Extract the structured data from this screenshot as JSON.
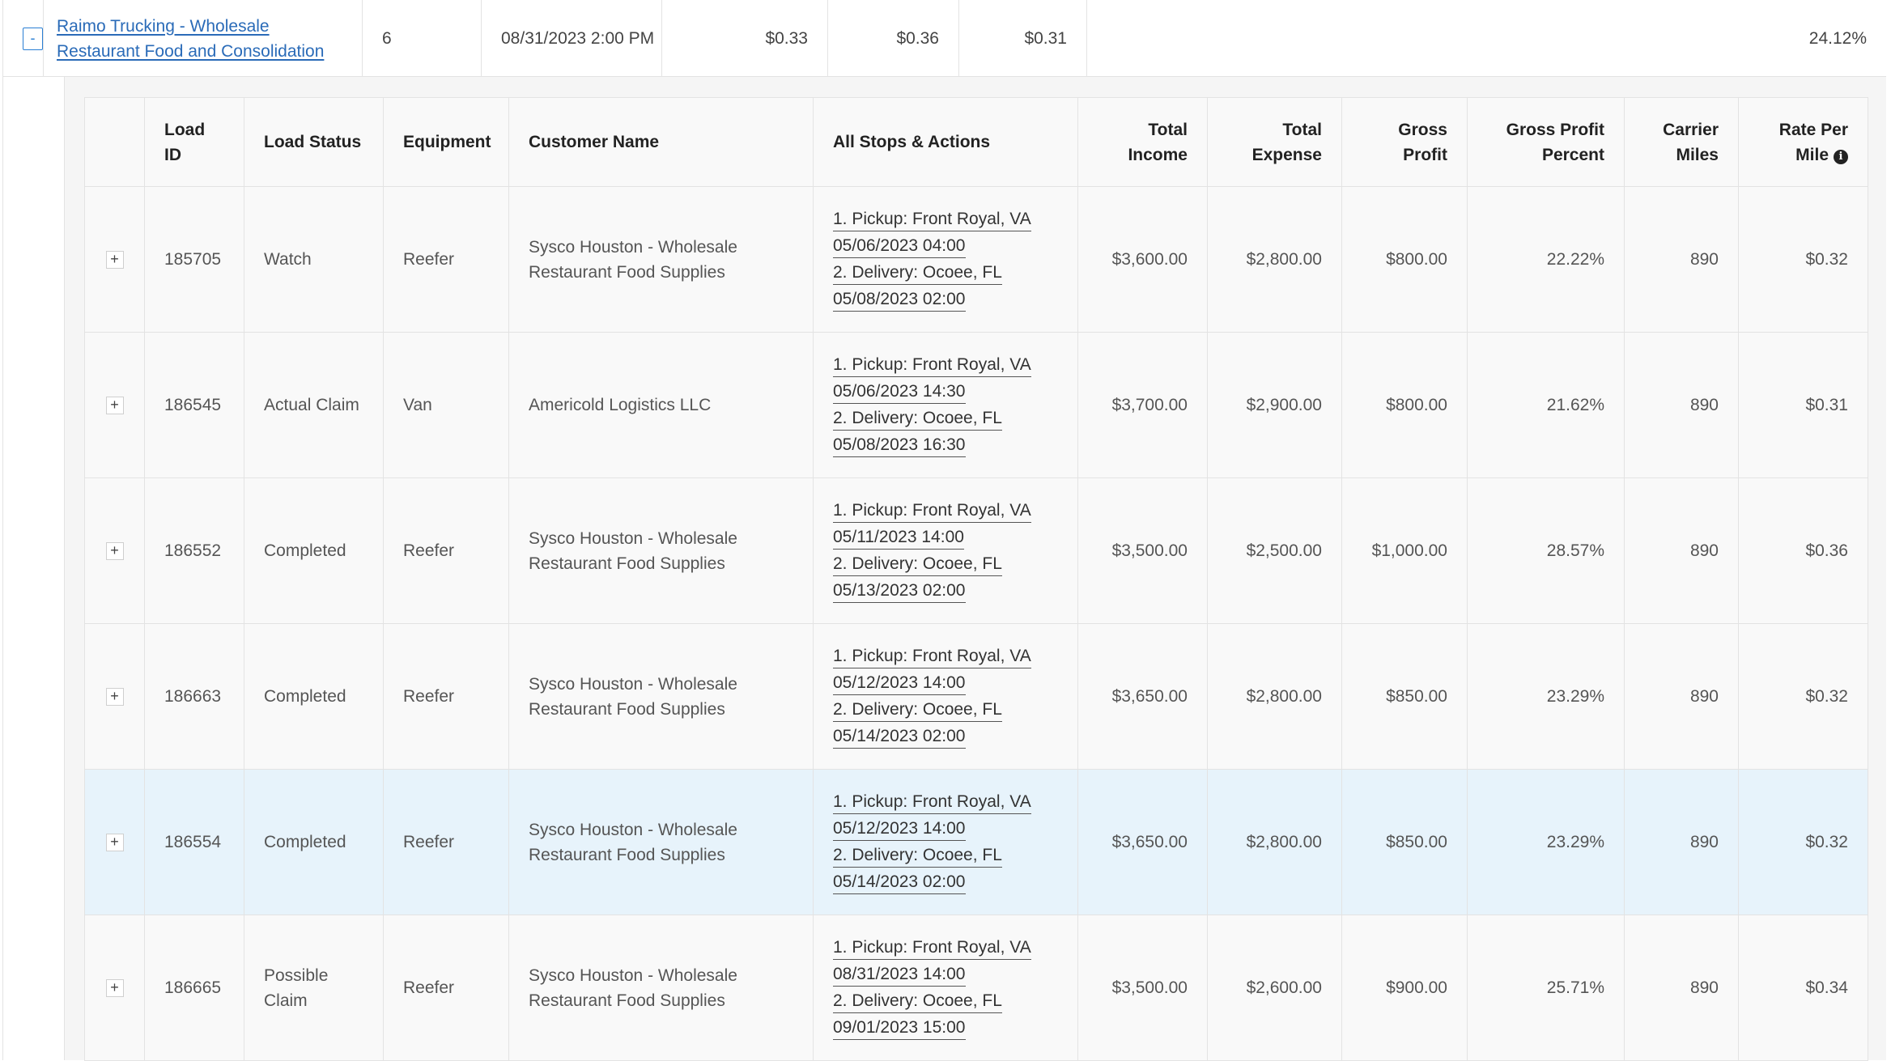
{
  "parent_row": {
    "toggle": "-",
    "carrier_name": "Raimo Trucking - Wholesale Restaurant Food and Consolidation",
    "count": "6",
    "datetime": "08/31/2023 2:00 PM",
    "val1": "$0.33",
    "val2": "$0.36",
    "val3": "$0.31",
    "percent": "24.12%"
  },
  "table": {
    "headers": {
      "load_id": "Load ID",
      "load_status": "Load Status",
      "equipment": "Equipment",
      "customer_name": "Customer Name",
      "all_stops": "All Stops & Actions",
      "total_income": "Total Income",
      "total_expense": "Total Expense",
      "gross_profit": "Gross Profit",
      "gross_profit_percent": "Gross Profit Percent",
      "carrier_miles": "Carrier Miles",
      "rate_per_mile": "Rate Per Mile"
    },
    "expand_symbol": "+",
    "rows": [
      {
        "load_id": "185705",
        "status": "Watch",
        "equipment": "Reefer",
        "customer": "Sysco Houston - Wholesale Restaurant Food Supplies",
        "stops": [
          "1. Pickup: Front Royal, VA",
          "05/06/2023 04:00",
          "2. Delivery: Ocoee, FL",
          "05/08/2023 02:00"
        ],
        "income": "$3,600.00",
        "expense": "$2,800.00",
        "profit": "$800.00",
        "percent": "22.22%",
        "miles": "890",
        "rate": "$0.32"
      },
      {
        "load_id": "186545",
        "status": "Actual Claim",
        "equipment": "Van",
        "customer": "Americold Logistics LLC",
        "stops": [
          "1. Pickup: Front Royal, VA",
          "05/06/2023 14:30",
          "2. Delivery: Ocoee, FL",
          "05/08/2023 16:30"
        ],
        "income": "$3,700.00",
        "expense": "$2,900.00",
        "profit": "$800.00",
        "percent": "21.62%",
        "miles": "890",
        "rate": "$0.31"
      },
      {
        "load_id": "186552",
        "status": "Completed",
        "equipment": "Reefer",
        "customer": "Sysco Houston - Wholesale Restaurant Food Supplies",
        "stops": [
          "1. Pickup: Front Royal, VA",
          "05/11/2023 14:00",
          "2. Delivery: Ocoee, FL",
          "05/13/2023 02:00"
        ],
        "income": "$3,500.00",
        "expense": "$2,500.00",
        "profit": "$1,000.00",
        "percent": "28.57%",
        "miles": "890",
        "rate": "$0.36"
      },
      {
        "load_id": "186663",
        "status": "Completed",
        "equipment": "Reefer",
        "customer": "Sysco Houston - Wholesale Restaurant Food Supplies",
        "stops": [
          "1. Pickup: Front Royal, VA",
          "05/12/2023 14:00",
          "2. Delivery: Ocoee, FL",
          "05/14/2023 02:00"
        ],
        "income": "$3,650.00",
        "expense": "$2,800.00",
        "profit": "$850.00",
        "percent": "23.29%",
        "miles": "890",
        "rate": "$0.32"
      },
      {
        "load_id": "186554",
        "status": "Completed",
        "equipment": "Reefer",
        "customer": "Sysco Houston - Wholesale Restaurant Food Supplies",
        "stops": [
          "1. Pickup: Front Royal, VA",
          "05/12/2023 14:00",
          "2. Delivery: Ocoee, FL",
          "05/14/2023 02:00"
        ],
        "income": "$3,650.00",
        "expense": "$2,800.00",
        "profit": "$850.00",
        "percent": "23.29%",
        "miles": "890",
        "rate": "$0.32",
        "highlighted": true
      },
      {
        "load_id": "186665",
        "status": "Possible Claim",
        "equipment": "Reefer",
        "customer": "Sysco Houston - Wholesale Restaurant Food Supplies",
        "stops": [
          "1. Pickup: Front Royal, VA",
          "08/31/2023 14:00",
          "2. Delivery: Ocoee, FL",
          "09/01/2023 15:00"
        ],
        "income": "$3,500.00",
        "expense": "$2,600.00",
        "profit": "$900.00",
        "percent": "25.71%",
        "miles": "890",
        "rate": "$0.34"
      }
    ]
  },
  "colors": {
    "link": "#2a6bb8",
    "row_highlight": "#e7f3fb",
    "border": "#e3e3e3"
  },
  "icons": {
    "rate_info": "info-circle-icon",
    "collapse": "collapse-icon",
    "expand": "expand-icon"
  }
}
